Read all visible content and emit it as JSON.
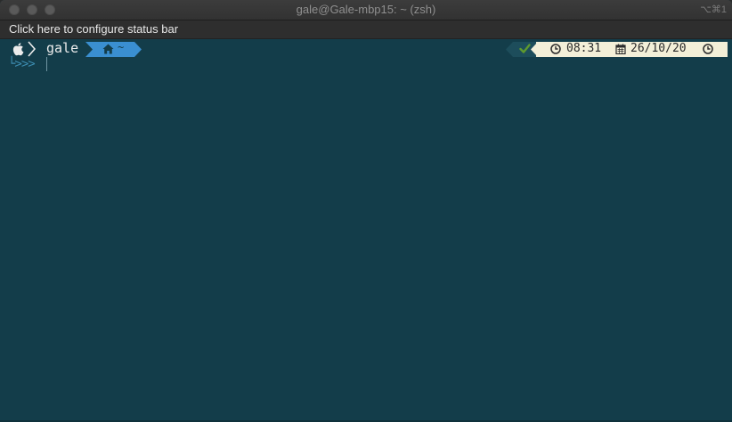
{
  "window": {
    "title": "gale@Gale-mbp15: ~ (zsh)",
    "shortcut": "⌥⌘1"
  },
  "statusbar": {
    "label": "Click here to configure status bar"
  },
  "prompt": {
    "user": "gale",
    "directory": "~",
    "arrows": "└>>>",
    "time": "08:31",
    "date": "26/10/20"
  },
  "colors": {
    "background": "#133d4a",
    "dir_segment": "#3a8fd1",
    "status_ok": "#5f9a2e",
    "time_segment": "#f3efd8"
  },
  "icons": {
    "apple": "apple-icon",
    "home": "home-icon",
    "check": "check-icon",
    "clock": "clock-icon",
    "calendar": "calendar-icon"
  }
}
